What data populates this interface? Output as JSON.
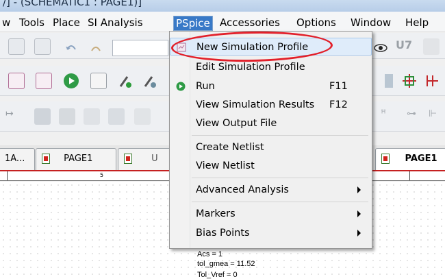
{
  "window": {
    "title": "/] - (SCHEMATIC1 : PAGE1)]"
  },
  "menubar": {
    "items": [
      {
        "label": "w"
      },
      {
        "label": "Tools"
      },
      {
        "label": "Place"
      },
      {
        "label": "SI Analysis"
      },
      {
        "label": "PSpice"
      },
      {
        "label": "Accessories"
      },
      {
        "label": "Options"
      },
      {
        "label": "Window"
      },
      {
        "label": "Help"
      }
    ],
    "active": "PSpice"
  },
  "pspice_menu": {
    "items": [
      {
        "label": "New Simulation Profile",
        "highlighted": true,
        "icon": "simulation-profile-icon"
      },
      {
        "label": "Edit Simulation Profile"
      },
      {
        "label": "Run",
        "shortcut": "F11",
        "icon": "run-icon"
      },
      {
        "label": "View Simulation Results",
        "shortcut": "F12"
      },
      {
        "label": "View Output File"
      },
      {
        "label": "Create Netlist"
      },
      {
        "label": "View Netlist"
      },
      {
        "label": "Advanced Analysis",
        "submenu": true
      },
      {
        "label": "Markers",
        "submenu": true
      },
      {
        "label": "Bias Points",
        "submenu": true
      }
    ]
  },
  "tabs": [
    {
      "label": "1A..."
    },
    {
      "label": "PAGE1"
    },
    {
      "label": "U"
    },
    {
      "label": "PAGE1"
    }
  ],
  "ruler": {
    "marker": "5"
  },
  "canvas": {
    "annotations": [
      "Acs = 1",
      "tol_gmea = 11.52",
      "Tol_Vref = 0"
    ]
  },
  "colors": {
    "highlight_circle": "#e2202a",
    "tab_underline": "#c52020",
    "menu_hover": "#dfecfa"
  }
}
